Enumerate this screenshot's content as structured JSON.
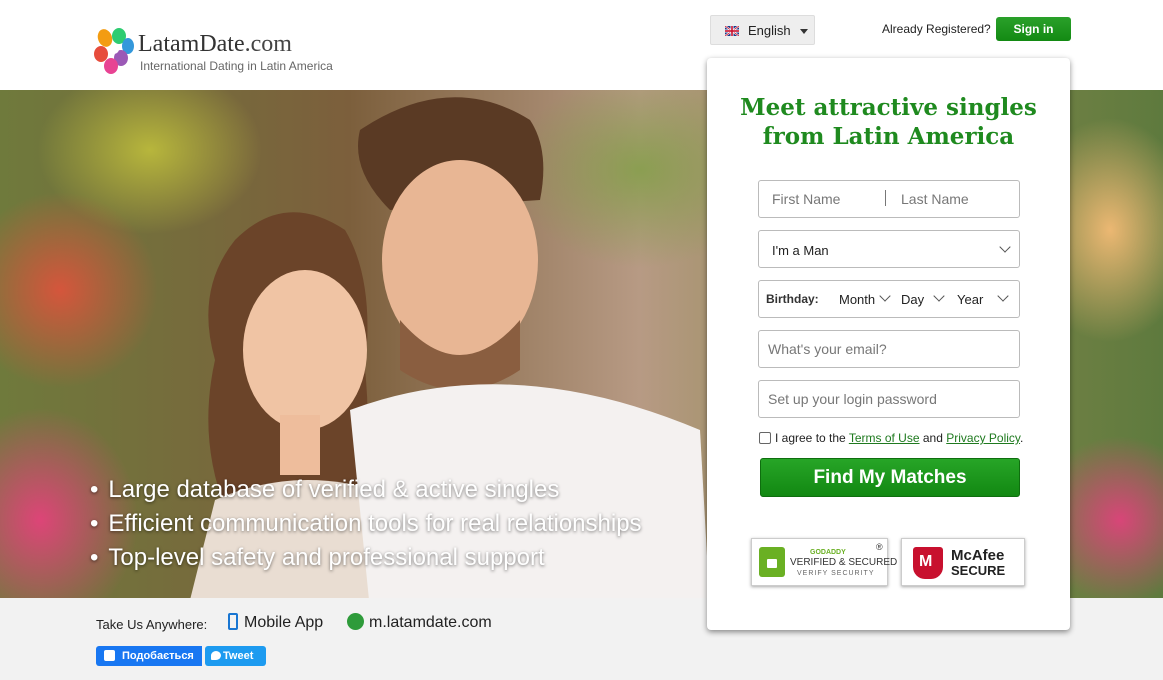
{
  "header": {
    "logo_name": "Latam",
    "logo_name_accent": "Date",
    "logo_suffix": ".com",
    "tagline": "International Dating in Latin America",
    "language": "English",
    "already_registered": "Already Registered?",
    "sign_in_label": "Sign in",
    "colors": {
      "brand_green": "#1f8a1f",
      "button_green": "#128812"
    }
  },
  "hero": {
    "bullets": [
      "Large database of verified & active singles",
      "Efficient communication tools for real relationships",
      "Top-level safety and professional support"
    ]
  },
  "signup": {
    "title_line1": "Meet attractive singles",
    "title_line2": "from Latin America",
    "first_name_placeholder": "First Name",
    "last_name_placeholder": "Last Name",
    "gender_value": "I'm a Man",
    "birthday_label": "Birthday:",
    "month_label": "Month",
    "day_label": "Day",
    "year_label": "Year",
    "email_placeholder": "What's your email?",
    "password_placeholder": "Set up your login password",
    "agree_prefix": "I agree to the",
    "terms_label": "Terms of Use",
    "agree_and": "and",
    "privacy_label": "Privacy Policy",
    "agree_suffix": ".",
    "submit_label": "Find My Matches",
    "badges": {
      "godaddy_top": "GODADDY",
      "godaddy_main": "VERIFIED & SECURED",
      "godaddy_sub": "VERIFY SECURITY",
      "godaddy_reg": "®",
      "mcafee_mark": "M",
      "mcafee_name": "McAfee",
      "mcafee_secure": "SECURE"
    }
  },
  "footer": {
    "take_us": "Take Us Anywhere:",
    "mobile_app": "Mobile App",
    "mobile_site": "m.latamdate.com",
    "like_label": "Подобається",
    "tweet_label": "Tweet"
  }
}
